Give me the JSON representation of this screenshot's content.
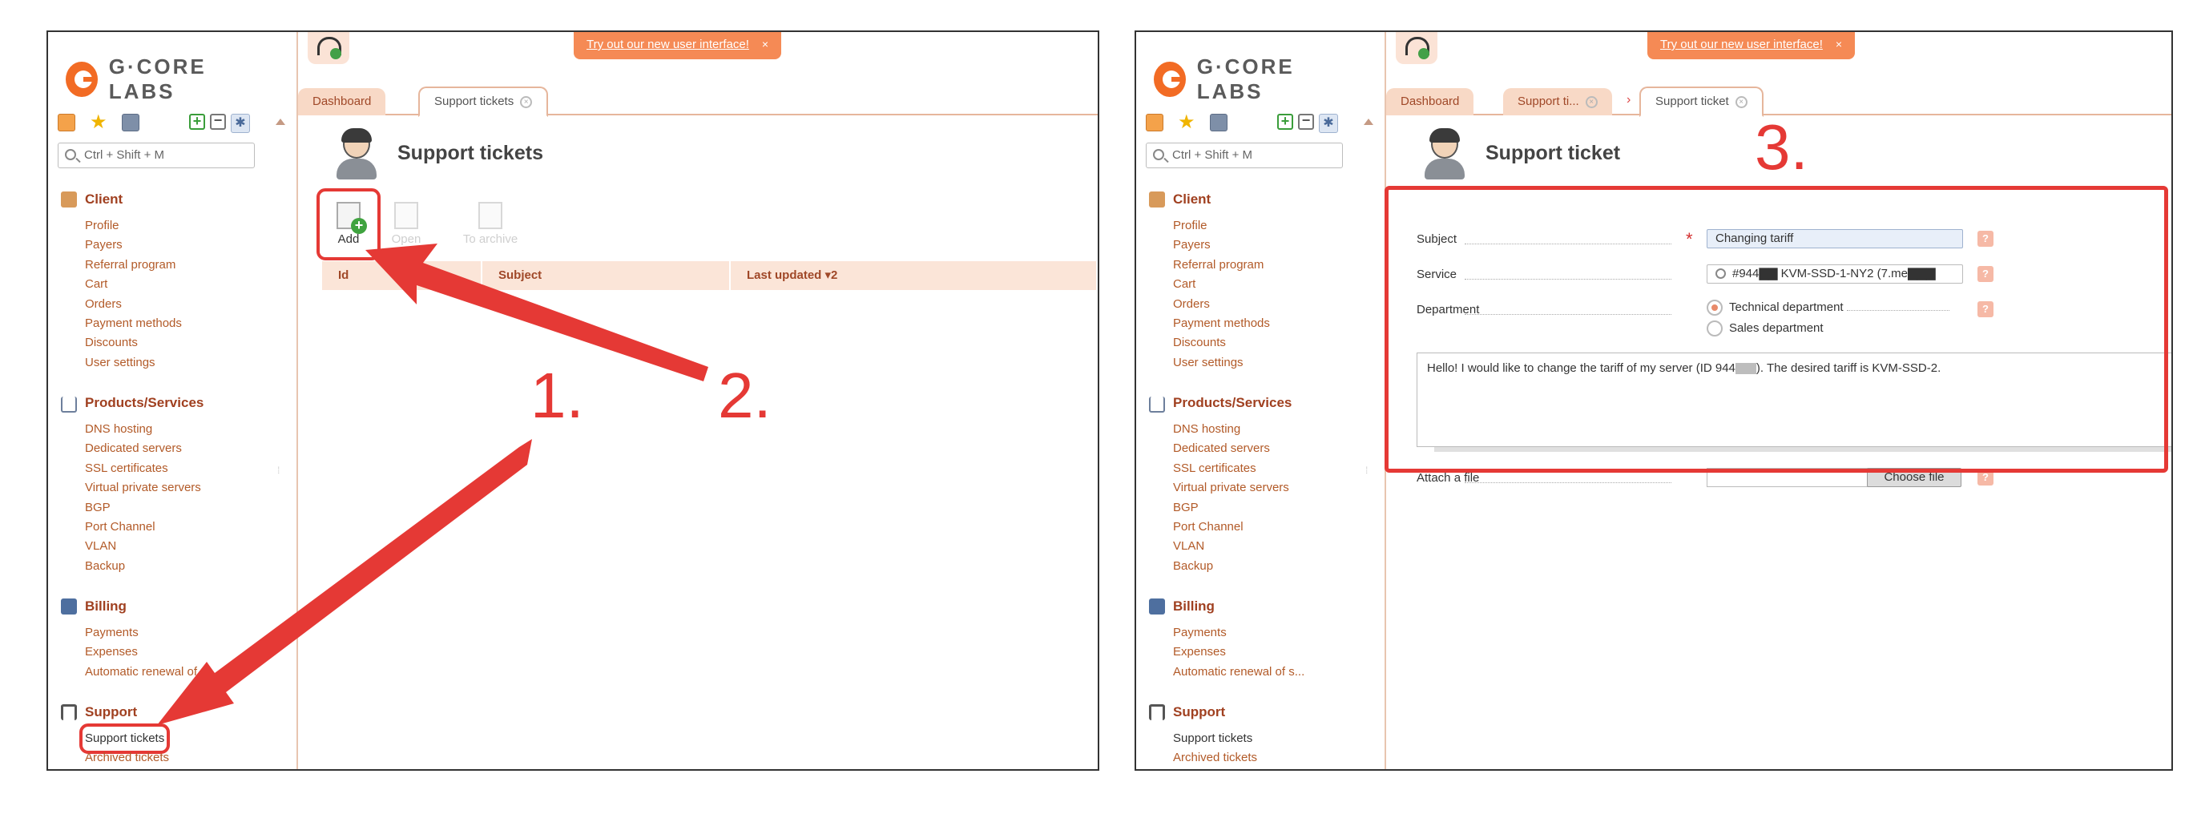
{
  "annotations": {
    "step1": "1.",
    "step2": "2.",
    "step3": "3.",
    "color": "#e53935"
  },
  "left": {
    "logo": "G·CORE LABS",
    "search_placeholder": "Ctrl + Shift + M",
    "promo": {
      "text": "Try out our new user interface!",
      "close": "×"
    },
    "tabs": [
      {
        "label": "Dashboard"
      },
      {
        "label": "Support tickets"
      }
    ],
    "groups": [
      {
        "title": "Client",
        "icon": "client-icon",
        "items": [
          "Profile",
          "Payers",
          "Referral program",
          "Cart",
          "Orders",
          "Payment methods",
          "Discounts",
          "User settings"
        ]
      },
      {
        "title": "Products/Services",
        "icon": "cart-icon",
        "items": [
          "DNS hosting",
          "Dedicated servers",
          "SSL certificates",
          "Virtual private servers",
          "BGP",
          "Port Channel",
          "VLAN",
          "Backup"
        ]
      },
      {
        "title": "Billing",
        "icon": "billing-icon",
        "items": [
          "Payments",
          "Expenses",
          "Automatic renewal of s"
        ]
      },
      {
        "title": "Support",
        "icon": "headset-icon",
        "items": [
          "Support tickets",
          "Archived tickets"
        ]
      }
    ],
    "page_title": "Support tickets",
    "toolbar": [
      {
        "label": "Add"
      },
      {
        "label": "Open"
      },
      {
        "label": "To archive"
      }
    ],
    "table_headers": [
      "Id",
      "Subject",
      "Last updated ▾2"
    ]
  },
  "right": {
    "logo": "G·CORE LABS",
    "search_placeholder": "Ctrl + Shift + M",
    "promo": {
      "text": "Try out our new user interface!",
      "close": "×"
    },
    "tabs": [
      {
        "label": "Dashboard"
      },
      {
        "label": "Support ti..."
      },
      {
        "label": "Support ticket"
      }
    ],
    "groups": [
      {
        "title": "Client",
        "items": [
          "Profile",
          "Payers",
          "Referral program",
          "Cart",
          "Orders",
          "Payment methods",
          "Discounts",
          "User settings"
        ]
      },
      {
        "title": "Products/Services",
        "items": [
          "DNS hosting",
          "Dedicated servers",
          "SSL certificates",
          "Virtual private servers",
          "BGP",
          "Port Channel",
          "VLAN",
          "Backup"
        ]
      },
      {
        "title": "Billing",
        "items": [
          "Payments",
          "Expenses",
          "Automatic renewal of s..."
        ]
      },
      {
        "title": "Support",
        "items": [
          "Support tickets",
          "Archived tickets"
        ]
      }
    ],
    "page_title": "Support ticket",
    "form": {
      "subject_label": "Subject",
      "subject_value": "Changing tariff",
      "service_label": "Service",
      "service_value": "#944▇▇ KVM-SSD-1-NY2 (7.me▇▇▇",
      "department_label": "Department",
      "department_options": [
        "Technical department",
        "Sales department"
      ],
      "message_before": "Hello! I would like to change the tariff of my server (ID 944",
      "message_after": "). The desired tariff is KVM-SSD-2.",
      "attach_label": "Attach a file",
      "choose_label": "Choose file",
      "help": "?",
      "required": "*"
    }
  }
}
